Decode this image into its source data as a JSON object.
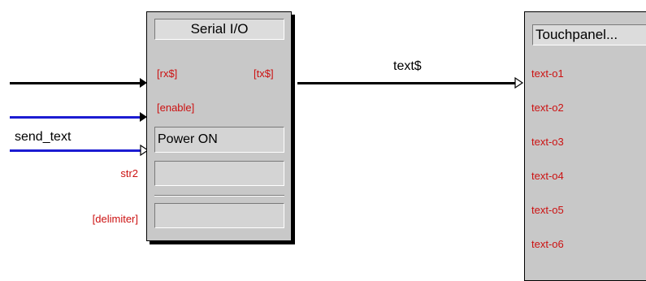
{
  "serial_io": {
    "title": "Serial I/O",
    "inputs": [
      "[rx$]",
      "[enable]"
    ],
    "output": "[tx$]",
    "parameters": [
      "Power ON",
      "",
      ""
    ],
    "parameter_labels": [
      "str2",
      "[delimiter]"
    ]
  },
  "touchpanel": {
    "title": "Touchpanel...",
    "inputs": [
      "text-o1",
      "text-o2",
      "text-o3",
      "text-o4",
      "text-o5",
      "text-o6"
    ]
  },
  "wires": {
    "output_signal": "text$",
    "input_signal": "send_text"
  },
  "colors": {
    "signal_label": "#cc1111",
    "digital_wire": "#1c1cd2",
    "serial_wire": "#000000",
    "block_fill": "#c8c8c8"
  }
}
